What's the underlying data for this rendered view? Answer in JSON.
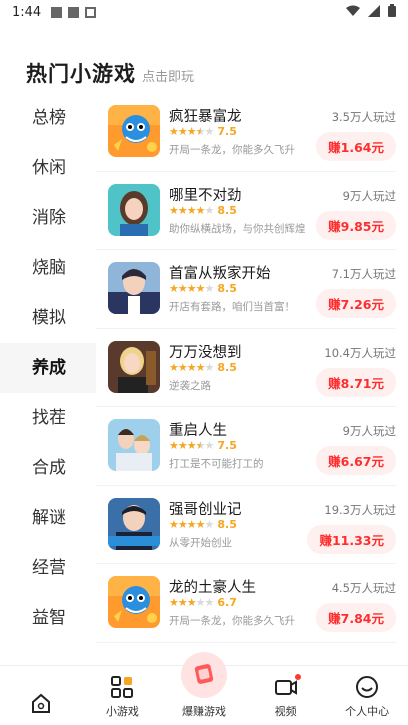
{
  "status": {
    "time": "1:44"
  },
  "header": {
    "title": "热门小游戏",
    "subtitle": "点击即玩"
  },
  "categories": [
    {
      "label": "总榜",
      "active": false
    },
    {
      "label": "休闲",
      "active": false
    },
    {
      "label": "消除",
      "active": false
    },
    {
      "label": "烧脑",
      "active": false
    },
    {
      "label": "模拟",
      "active": false
    },
    {
      "label": "养成",
      "active": true
    },
    {
      "label": "找茬",
      "active": false
    },
    {
      "label": "合成",
      "active": false
    },
    {
      "label": "解谜",
      "active": false
    },
    {
      "label": "经营",
      "active": false
    },
    {
      "label": "益智",
      "active": false
    }
  ],
  "games": [
    {
      "name": "疯狂暴富龙",
      "rating": 3.5,
      "score": "7.5",
      "desc": "开局一条龙，你能多久飞升",
      "played": "3.5万人玩过",
      "earn": "赚1.64元",
      "thumb": "dragon"
    },
    {
      "name": "哪里不对劲",
      "rating": 4,
      "score": "8.5",
      "desc": "助你纵横战场，与你共创辉煌",
      "played": "9万人玩过",
      "earn": "赚9.85元",
      "thumb": "girl"
    },
    {
      "name": "首富从叛家开始",
      "rating": 4,
      "score": "8.5",
      "desc": "开店有套路，咱们当首富！",
      "played": "7.1万人玩过",
      "earn": "赚7.26元",
      "thumb": "man"
    },
    {
      "name": "万万没想到",
      "rating": 4,
      "score": "8.5",
      "desc": "逆袭之路",
      "played": "10.4万人玩过",
      "earn": "赚8.71元",
      "thumb": "blonde"
    },
    {
      "name": "重启人生",
      "rating": 3.5,
      "score": "7.5",
      "desc": "打工是不可能打工的",
      "played": "9万人玩过",
      "earn": "赚6.67元",
      "thumb": "couple"
    },
    {
      "name": "强哥创业记",
      "rating": 4,
      "score": "8.5",
      "desc": "从零开始创业",
      "played": "19.3万人玩过",
      "earn": "赚11.33元",
      "thumb": "suit"
    },
    {
      "name": "龙的土豪人生",
      "rating": 3,
      "score": "6.7",
      "desc": "开局一条龙，你能多久飞升",
      "played": "4.5万人玩过",
      "earn": "赚7.84元",
      "thumb": "dragon"
    }
  ],
  "tabbar": [
    {
      "label": "",
      "icon": "home-icon"
    },
    {
      "label": "小游戏",
      "icon": "grid-icon"
    },
    {
      "label": "爆赚游戏",
      "icon": "money-icon"
    },
    {
      "label": "视频",
      "icon": "video-icon"
    },
    {
      "label": "个人中心",
      "icon": "smile-icon"
    }
  ],
  "colors": {
    "accent": "#ff2d2d",
    "star": "#f5a623",
    "earnBg": "#fff0f0"
  }
}
